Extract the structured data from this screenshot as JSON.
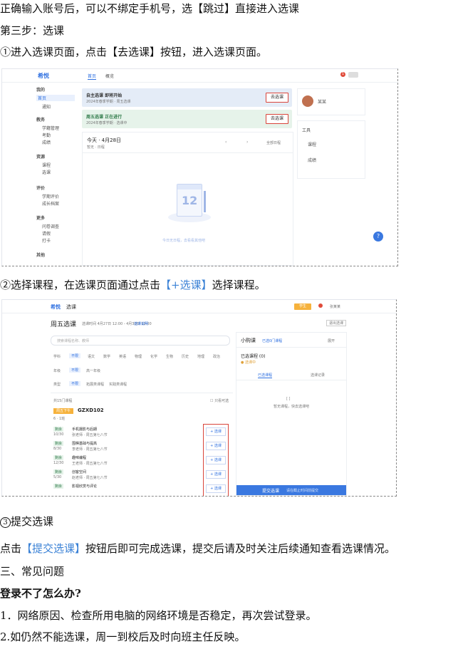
{
  "doc": {
    "line1": "正确输入账号后，可以不绑定手机号，选【跳过】直接进入选课",
    "step3": "第三步：选课",
    "sub1": "①进入选课页面，点击【去选课】按钮，进入选课页面。",
    "sub2_a": "②选择课程，在选课页面通过点击",
    "sub2_link": "【+选课】",
    "sub2_b": "选择课程。",
    "sub3": "提交选课",
    "sub3_num": "3",
    "submit_a": "点击",
    "submit_link": "【提交选课】",
    "submit_b": "按钮后即可完成选课，提交后请及时关注后续通知查看选课情况。",
    "faq_title": "三、常见问题",
    "faq_q": "登录不了怎么办?",
    "faq_1": "1．网络原因、检查所用电脑的网络环境是否稳定，再次尝试登录。",
    "faq_2": "2.如仍然不能选课，周一到校后及时向班主任反映。"
  },
  "shot1": {
    "logo": "希悦",
    "tab1": "首页",
    "tab2": "概览",
    "badge": "1",
    "sidebar": [
      "我的",
      "首页",
      "通知",
      "教务",
      "学籍管理",
      "考勤",
      "成绩",
      "资源",
      "课程",
      "选课",
      "评价",
      "学期评价",
      "成长档案",
      "更多",
      "问卷调查",
      "请假",
      "打卡",
      "其他"
    ],
    "card1_title": "自主选课 即将开始",
    "card1_sub": "2024年春季学期 · 周五选课",
    "card2_title": "周五选课 正在进行",
    "card2_sub": "2024年春季学期 · 选课中",
    "go_btn": "去选课",
    "today": "今天 · 4月28日",
    "today_sub": "暂无 · 日程",
    "calendar_link": "全部日程",
    "calendar_day": "12",
    "empty_text": "今日无日程，去看看其他吧",
    "right_user": "某某",
    "right_tools": [
      "工具",
      "课程",
      "成绩"
    ],
    "help": "?"
  },
  "shot2": {
    "logo": "希悦",
    "title_suffix": "选课",
    "top_badge": "学生",
    "top_user": "张某某",
    "page_title": "周五选课",
    "page_meta": "选课时间 4月27日 12:00 - 4月30日 12:00",
    "page_link": "选课说明",
    "exit": "退出选课",
    "search_ph": "搜索课程名称、教师",
    "sort": "默认",
    "filter1_label": "学科",
    "filter1_opts": [
      "不限",
      "语文",
      "数学",
      "英语",
      "物理",
      "化学",
      "生物",
      "历史",
      "地理",
      "政治",
      "更多"
    ],
    "filter2_label": "年级",
    "filter2_opts": [
      "不限",
      "高一年级"
    ],
    "filter3_label": "类型",
    "filter3_opts": [
      "不限",
      "拓展类课程",
      "实践类课程"
    ],
    "list_header": "共15门课程",
    "list_check": "只看可选",
    "course_tag": "周五下午",
    "course_code": "GZXD102",
    "course_meta": "6 · 1班",
    "rows": [
      {
        "t1": "剩余",
        "t2": "10/30",
        "name": "手机摄影与后期",
        "meta": "张老师 · 周五第七八节"
      },
      {
        "t1": "剩余",
        "t2": "8/30",
        "name": "围棋基础与提高",
        "meta": "李老师 · 周五第七八节"
      },
      {
        "t1": "剩余",
        "t2": "12/30",
        "name": "趣味编程",
        "meta": "王老师 · 周五第七八节"
      },
      {
        "t1": "剩余",
        "t2": "5/30",
        "name": "创客空间",
        "meta": "赵老师 · 周五第七八节"
      },
      {
        "t1": "剩余",
        "t2": "9/30",
        "name": "影视欣赏与评论",
        "meta": "刘老师 · 周五第七八节"
      }
    ],
    "add_btn": "+ 选课",
    "panel_title": "小购课",
    "panel_sub": "已选0门课程",
    "panel_more": "展开",
    "chosen": "已选课程 (0)",
    "chosen_sub": "● 选课中",
    "ptab1": "已选课程",
    "ptab2": "选课记录",
    "empty": "暂无课程，快去选课吧",
    "empty_icon": "[ ]",
    "submit_btn": "提交选课",
    "submit_hint": "请在截止时间前提交"
  }
}
